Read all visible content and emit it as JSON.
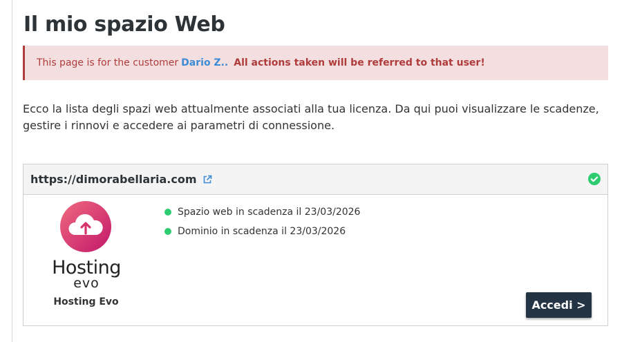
{
  "page": {
    "title": "Il mio spazio Web"
  },
  "alert": {
    "prefix": "This page is for the customer",
    "customer_name": "Dario Z..",
    "warning": "All actions taken will be referred to that user!"
  },
  "intro_text": "Ecco la lista degli spazi web attualmente associati alla tua licenza. Da qui puoi visualizzare le scadenze, gestire i rinnovi e accedere ai parametri di connessione.",
  "web_space": {
    "domain": "https://dimorabellaria.com",
    "external_link_icon": "external-link-icon",
    "status_icon": "check-circle-icon",
    "status_color": "#2ecc71",
    "product": {
      "logo_text": "Hosting",
      "logo_subtext": "evo",
      "name": "Hosting Evo"
    },
    "statuses": [
      {
        "text": "Spazio web in scadenza il 23/03/2026",
        "color": "#2ecc71"
      },
      {
        "text": "Dominio in scadenza il 23/03/2026",
        "color": "#2ecc71"
      }
    ],
    "access_button": "Accedi >"
  },
  "colors": {
    "title": "#2d3336",
    "alert_bg": "#f3dfe0",
    "alert_text": "#b03b3b",
    "link": "#3d8bd6",
    "button_bg": "#243445",
    "brand_gradient_start": "#f06a7e",
    "brand_gradient_end": "#c2186b"
  }
}
